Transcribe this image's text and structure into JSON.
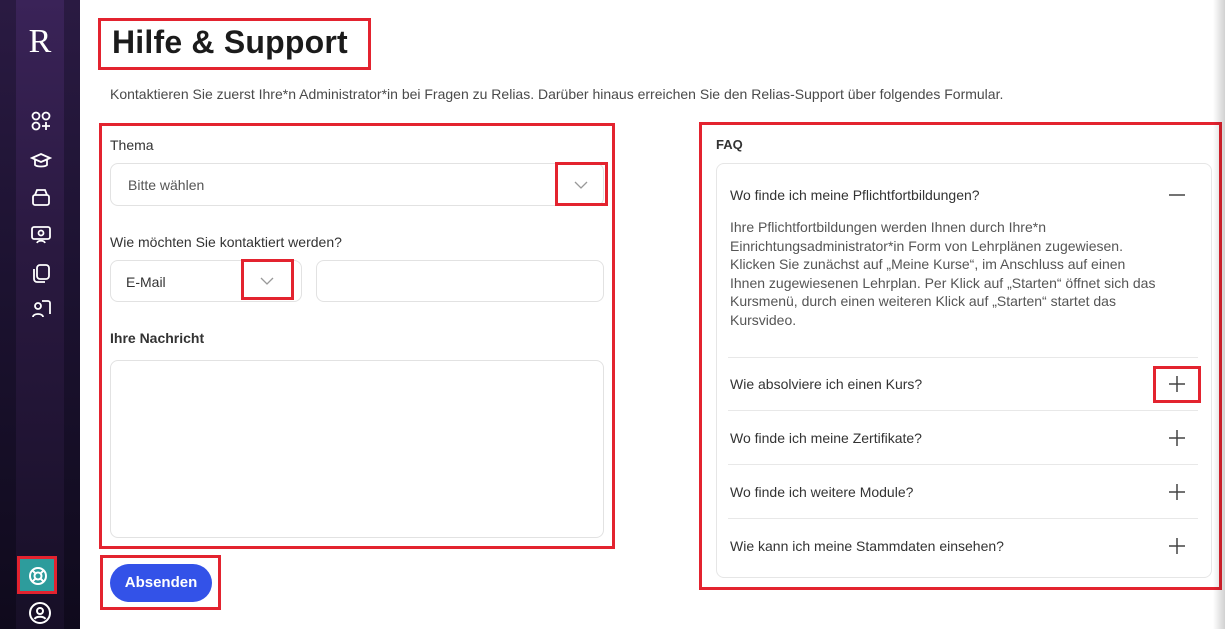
{
  "app": {
    "logo_letter": "R"
  },
  "page": {
    "title": "Hilfe & Support",
    "intro": "Kontaktieren Sie zuerst Ihre*n Administrator*in bei Fragen zu Relias. Darüber hinaus erreichen Sie den Relias-Support über folgendes Formular."
  },
  "sidebar": {
    "icons": [
      "dashboard-icon",
      "graduation-cap-icon",
      "courses-icon",
      "presentation-icon",
      "library-icon",
      "profile-card-icon"
    ],
    "help_icon": "lifebuoy-icon",
    "user_icon": "user-circle-icon"
  },
  "form": {
    "topic_label": "Thema",
    "topic_placeholder": "Bitte wählen",
    "contact_label": "Wie möchten Sie kontaktiert werden?",
    "contact_method": "E-Mail",
    "contact_value": "",
    "message_label": "Ihre Nachricht",
    "message_value": "",
    "submit_label": "Absenden"
  },
  "faq": {
    "title": "FAQ",
    "items": [
      {
        "question": "Wo finde ich meine Pflichtfortbildungen?",
        "expanded": true,
        "answer_lines": [
          "Ihre Pflichtfortbildungen werden Ihnen durch Ihre*n",
          "Einrichtungsadministrator*in Form von Lehrplänen zugewiesen.",
          "Klicken Sie zunächst auf „Meine Kurse“, im Anschluss auf einen",
          "Ihnen zugewiesenen Lehrplan. Per Klick auf „Starten“ öffnet sich das",
          "Kursmenü, durch einen weiteren Klick auf „Starten“ startet das",
          "Kursvideo."
        ]
      },
      {
        "question": "Wie absolviere ich einen Kurs?",
        "expanded": false
      },
      {
        "question": "Wo finde ich meine Zertifikate?",
        "expanded": false
      },
      {
        "question": "Wo finde ich weitere Module?",
        "expanded": false
      },
      {
        "question": "Wie kann ich meine Stammdaten einsehen?",
        "expanded": false
      }
    ]
  },
  "colors": {
    "accent": "#3352e8",
    "highlight": "#e3232f",
    "sidebar": "#2a1a42",
    "help_active": "#2d9c9c"
  }
}
